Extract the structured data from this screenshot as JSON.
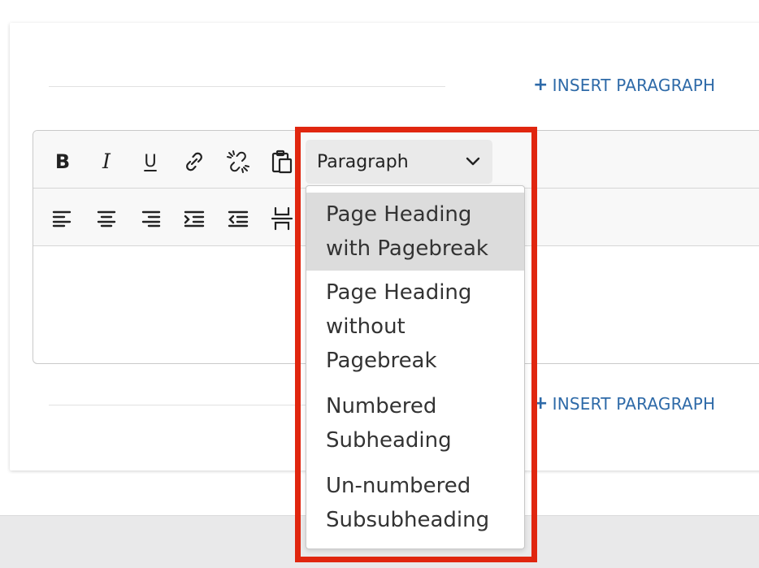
{
  "insert_paragraph": {
    "top_label": "INSERT PARAGRAPH",
    "bottom_label": "INSERT PARAGRAPH",
    "plus": "+"
  },
  "toolbar": {
    "bold": "B",
    "italic": "I",
    "underline": "U",
    "block_format": "Paragraph",
    "icons": [
      "bold-icon",
      "italic-icon",
      "underline-icon",
      "link-icon",
      "unlink-icon",
      "paste-icon",
      "align-left-icon",
      "align-center-icon",
      "align-right-icon",
      "indent-icon",
      "outdent-icon",
      "page-break-icon"
    ]
  },
  "dropdown": {
    "options": [
      {
        "label": "Page Heading with Pagebreak",
        "highlighted": true
      },
      {
        "label": "Page Heading without Pagebreak"
      },
      {
        "label": "Numbered Subheading"
      },
      {
        "label": "Un-numbered Subsubheading"
      }
    ]
  },
  "colors": {
    "accent_link": "#2e6aa8",
    "highlight_border": "#e0260f"
  }
}
